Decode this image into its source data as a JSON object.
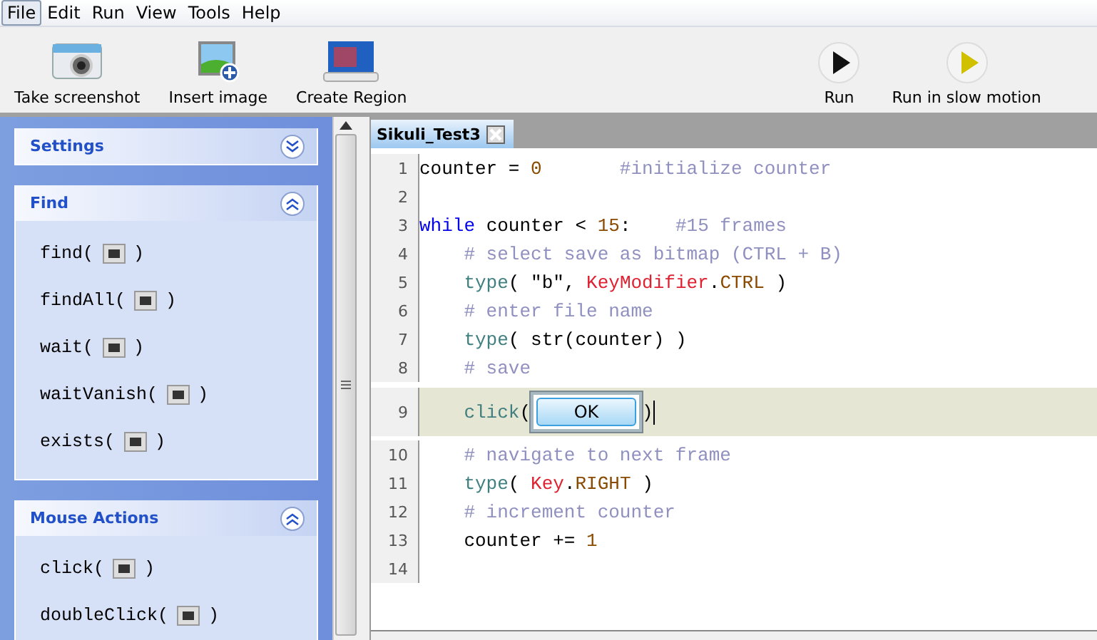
{
  "menu": [
    {
      "label": "File",
      "selected": true
    },
    {
      "label": "Edit",
      "selected": false
    },
    {
      "label": "Run",
      "selected": false
    },
    {
      "label": "View",
      "selected": false
    },
    {
      "label": "Tools",
      "selected": false
    },
    {
      "label": "Help",
      "selected": false
    }
  ],
  "toolbar_left": [
    {
      "kind": "camera",
      "label": "Take screenshot"
    },
    {
      "kind": "insert",
      "label": "Insert image"
    },
    {
      "kind": "region",
      "label": "Create Region"
    }
  ],
  "toolbar_right": [
    {
      "kind": "run",
      "label": "Run"
    },
    {
      "kind": "slow",
      "label": "Run in slow motion"
    }
  ],
  "sidebar": [
    {
      "title": "Settings",
      "expanded": false
    },
    {
      "title": "Find",
      "expanded": true,
      "items": [
        {
          "call": "find(",
          "close": ")"
        },
        {
          "call": "findAll(",
          "close": ")"
        },
        {
          "call": "wait(",
          "close": ")"
        },
        {
          "call": "waitVanish(",
          "close": ")"
        },
        {
          "call": "exists(",
          "close": ")"
        }
      ]
    },
    {
      "title": "Mouse Actions",
      "expanded": true,
      "items": [
        {
          "call": "click(",
          "close": ")"
        },
        {
          "call": "doubleClick(",
          "close": ")"
        }
      ]
    }
  ],
  "tab": {
    "label": "Sikuli_Test3"
  },
  "lines": [
    {
      "number": "1",
      "current": false,
      "tokens": [
        {
          "kind": "plain",
          "text": "counter = "
        },
        {
          "kind": "number",
          "text": "0"
        },
        {
          "kind": "comment",
          "text": "       #initialize counter"
        }
      ]
    },
    {
      "number": "2",
      "current": false
    },
    {
      "number": "3",
      "current": false,
      "tokens": [
        {
          "kind": "keyword",
          "text": "while"
        },
        {
          "kind": "plain",
          "text": " counter < "
        },
        {
          "kind": "number",
          "text": "15"
        },
        {
          "kind": "plain",
          "text": ":"
        },
        {
          "kind": "comment",
          "text": "    #15 frames"
        }
      ]
    },
    {
      "number": "4",
      "current": false,
      "tokens": [
        {
          "kind": "comment",
          "text": "    # select save as bitmap (CTRL + B)"
        }
      ]
    },
    {
      "number": "5",
      "current": false,
      "tokens": [
        {
          "kind": "func",
          "text": "    type"
        },
        {
          "kind": "plain",
          "text": "( "
        },
        {
          "kind": "string",
          "text": "\"b\""
        },
        {
          "kind": "plain",
          "text": ", "
        },
        {
          "kind": "class",
          "text": "KeyModifier"
        },
        {
          "kind": "plain",
          "text": "."
        },
        {
          "kind": "attr",
          "text": "CTRL"
        },
        {
          "kind": "plain",
          "text": " )"
        }
      ]
    },
    {
      "number": "6",
      "current": false,
      "tokens": [
        {
          "kind": "comment",
          "text": "    # enter file name"
        }
      ]
    },
    {
      "number": "7",
      "current": false,
      "tokens": [
        {
          "kind": "func",
          "text": "    type"
        },
        {
          "kind": "plain",
          "text": "( str(counter) )"
        }
      ]
    },
    {
      "number": "8",
      "current": false,
      "tokens": [
        {
          "kind": "comment",
          "text": "    # save"
        }
      ]
    },
    {
      "number": "9",
      "current": true,
      "tokens": [
        {
          "kind": "func",
          "text": "    click"
        },
        {
          "kind": "plain",
          "text": "("
        },
        {
          "kind": "image",
          "text": "OK"
        },
        {
          "kind": "plain",
          "text": ")"
        }
      ]
    },
    {
      "number": "10",
      "current": false,
      "tokens": [
        {
          "kind": "comment",
          "text": "    # navigate to next frame"
        }
      ]
    },
    {
      "number": "11",
      "current": false,
      "tokens": [
        {
          "kind": "func",
          "text": "    type"
        },
        {
          "kind": "plain",
          "text": "( "
        },
        {
          "kind": "class",
          "text": "Key"
        },
        {
          "kind": "plain",
          "text": "."
        },
        {
          "kind": "attr",
          "text": "RIGHT"
        },
        {
          "kind": "plain",
          "text": " )"
        }
      ]
    },
    {
      "number": "12",
      "current": false,
      "tokens": [
        {
          "kind": "comment",
          "text": "    # increment counter"
        }
      ]
    },
    {
      "number": "13",
      "current": false,
      "tokens": [
        {
          "kind": "plain",
          "text": "    counter += "
        },
        {
          "kind": "number",
          "text": "1"
        }
      ]
    },
    {
      "number": "14",
      "current": false
    }
  ]
}
